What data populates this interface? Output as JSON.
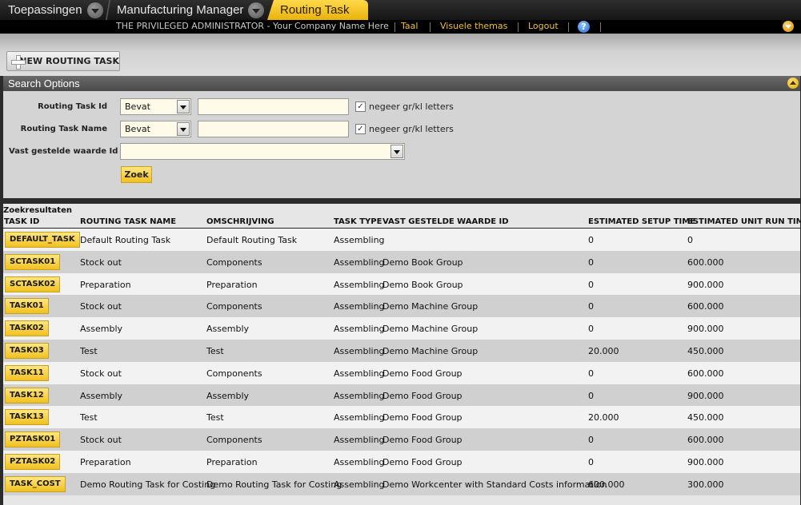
{
  "tabs": {
    "apps": "Toepassingen",
    "manager": "Manufacturing Manager",
    "active": "Routing Task"
  },
  "header": {
    "admin": "THE PRIVILEGED ADMINISTRATOR - Your Company Name Here",
    "language": "Taal",
    "themes": "Visuele themas",
    "logout": "Logout",
    "help": "?"
  },
  "toolbar": {
    "new_label": "NEW ROUTING TASK"
  },
  "search": {
    "title": "Search Options",
    "fields": [
      {
        "label": "Routing Task Id",
        "operator": "Bevat",
        "value": "",
        "ignore_case_label": "negeer gr/kl letters",
        "ignore_case": true
      },
      {
        "label": "Routing Task Name",
        "operator": "Bevat",
        "value": "",
        "ignore_case_label": "negeer gr/kl letters",
        "ignore_case": true
      },
      {
        "label": "Vast gestelde waarde Id",
        "value": ""
      }
    ],
    "submit": "Zoek"
  },
  "results": {
    "title": "Zoekresultaten",
    "columns": [
      "TASK ID",
      "ROUTING TASK NAME",
      "OMSCHRIJVING",
      "TASK TYPE",
      "VAST GESTELDE WAARDE ID",
      "ESTIMATED SETUP TIME",
      "ESTIMATED UNIT RUN TIME"
    ],
    "rows": [
      {
        "id": "DEFAULT_TASK",
        "name": "Default Routing Task",
        "desc": "Default Routing Task",
        "type": "Assembling",
        "fixed": "",
        "setup": "0",
        "run": "0"
      },
      {
        "id": "SCTASK01",
        "name": "Stock out",
        "desc": "Components",
        "type": "Assembling",
        "fixed": "Demo Book Group",
        "setup": "0",
        "run": "600.000"
      },
      {
        "id": "SCTASK02",
        "name": "Preparation",
        "desc": "Preparation",
        "type": "Assembling",
        "fixed": "Demo Book Group",
        "setup": "0",
        "run": "900.000"
      },
      {
        "id": "TASK01",
        "name": "Stock out",
        "desc": "Components",
        "type": "Assembling",
        "fixed": "Demo Machine Group",
        "setup": "0",
        "run": "600.000"
      },
      {
        "id": "TASK02",
        "name": "Assembly",
        "desc": "Assembly",
        "type": "Assembling",
        "fixed": "Demo Machine Group",
        "setup": "0",
        "run": "900.000"
      },
      {
        "id": "TASK03",
        "name": "Test",
        "desc": "Test",
        "type": "Assembling",
        "fixed": "Demo Machine Group",
        "setup": "20.000",
        "run": "450.000"
      },
      {
        "id": "TASK11",
        "name": "Stock out",
        "desc": "Components",
        "type": "Assembling",
        "fixed": "Demo Food Group",
        "setup": "0",
        "run": "600.000"
      },
      {
        "id": "TASK12",
        "name": "Assembly",
        "desc": "Assembly",
        "type": "Assembling",
        "fixed": "Demo Food Group",
        "setup": "0",
        "run": "900.000"
      },
      {
        "id": "TASK13",
        "name": "Test",
        "desc": "Test",
        "type": "Assembling",
        "fixed": "Demo Food Group",
        "setup": "20.000",
        "run": "450.000"
      },
      {
        "id": "PZTASK01",
        "name": "Stock out",
        "desc": "Components",
        "type": "Assembling",
        "fixed": "Demo Food Group",
        "setup": "0",
        "run": "600.000"
      },
      {
        "id": "PZTASK02",
        "name": "Preparation",
        "desc": "Preparation",
        "type": "Assembling",
        "fixed": "Demo Food Group",
        "setup": "0",
        "run": "900.000"
      },
      {
        "id": "TASK_COST",
        "name": "Demo Routing Task for Costing",
        "desc": "Demo Routing Task for Costing",
        "type": "Assembling",
        "fixed": "Demo Workcenter with Standard Costs information",
        "setup": "600.000",
        "run": "300.000"
      }
    ]
  },
  "colors": {
    "accent": "#f0c020",
    "link": "#f1c232",
    "header_bg": "#000000"
  }
}
